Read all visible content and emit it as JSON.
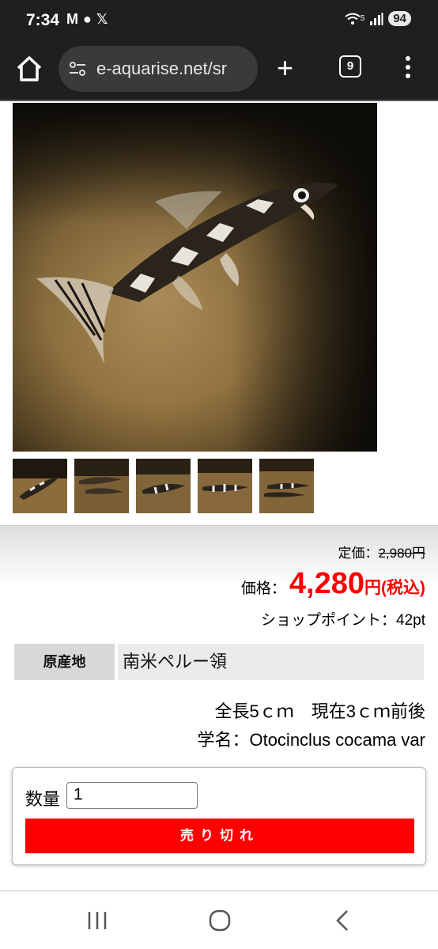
{
  "status_bar": {
    "time": "7:34",
    "notification_icons": [
      "M",
      "●",
      "𝕏"
    ],
    "battery": "94",
    "signal_label": "5"
  },
  "browser": {
    "url": "e-aquarise.net/sr",
    "tab_count": "9",
    "new_tab_label": "+"
  },
  "product": {
    "list_price_label": "定価：",
    "list_price_value": "2,980円",
    "price_label": "価格：",
    "price_value": "4,280",
    "price_unit": "円(税込)",
    "points_label": "ショップポイント：",
    "points_value": "42pt",
    "origin_label": "原産地",
    "origin_value": "南米ペルー領",
    "size_text": "全長5ｃｍ　現在3ｃｍ前後",
    "scientific_label": "学名：",
    "scientific_name": "Otocinclus cocama var"
  },
  "cart": {
    "qty_label": "数量",
    "qty_value": "1",
    "soldout_label": "売り切れ"
  },
  "images": {
    "main": "fish-photo",
    "thumbnails": [
      "fish-thumb-1",
      "fish-thumb-2",
      "fish-thumb-3",
      "fish-thumb-4",
      "fish-thumb-5"
    ]
  },
  "colors": {
    "accent_red": "#ff0000",
    "chrome_dark": "#1f1f1f"
  }
}
